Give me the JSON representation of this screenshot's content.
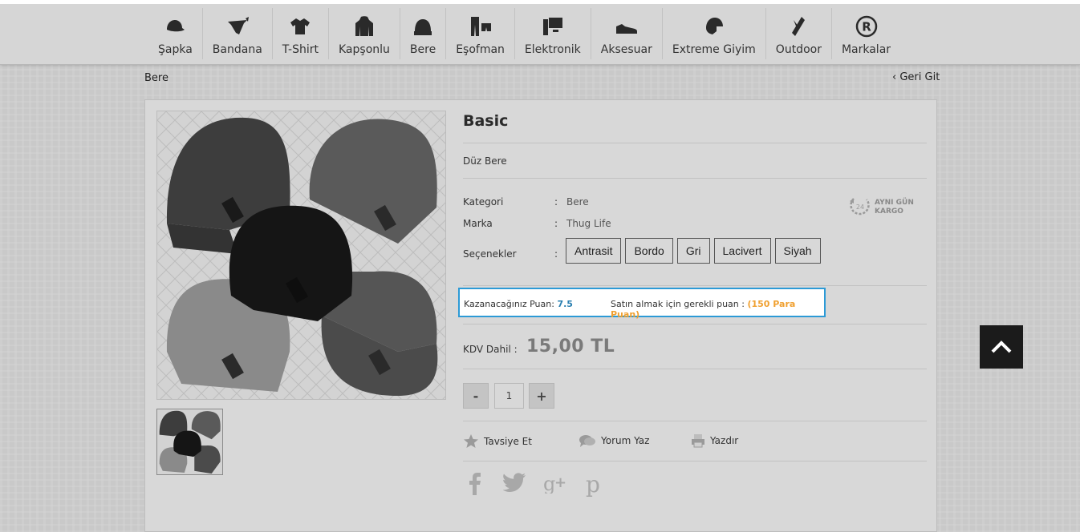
{
  "nav": {
    "items": [
      {
        "label": "Şapka",
        "icon": "cap-icon"
      },
      {
        "label": "Bandana",
        "icon": "bandana-icon"
      },
      {
        "label": "T-Shirt",
        "icon": "tshirt-icon"
      },
      {
        "label": "Kapşonlu",
        "icon": "hoodie-icon"
      },
      {
        "label": "Bere",
        "icon": "beanie-icon"
      },
      {
        "label": "Eşofman",
        "icon": "tracksuit-icon"
      },
      {
        "label": "Elektronik",
        "icon": "computer-icon"
      },
      {
        "label": "Aksesuar",
        "icon": "sneaker-icon"
      },
      {
        "label": "Extreme Giyim",
        "icon": "helmet-icon"
      },
      {
        "label": "Outdoor",
        "icon": "pocket-knife-icon"
      },
      {
        "label": "Markalar",
        "icon": "registered-icon"
      }
    ]
  },
  "breadcrumb": "Bere",
  "back_link": "Geri Git",
  "product": {
    "title": "Basic",
    "description": "Düz Bere",
    "attributes": {
      "category_label": "Kategori",
      "category_value": "Bere",
      "brand_label": "Marka",
      "brand_value": "Thug Life",
      "options_label": "Seçenekler",
      "colon": ":"
    },
    "options": [
      "Antrasit",
      "Bordo",
      "Gri",
      "Lacivert",
      "Siyah"
    ],
    "cargo": {
      "line1": "AYNI GÜN",
      "line2": "KARGO",
      "badge": "24"
    },
    "points": {
      "earn_label": "Kazanacağınız Puan:",
      "earn_value": "7.5",
      "required_label": "Satın almak için gerekli puan :",
      "required_value": "(150 Para Puan)"
    },
    "kdv_label": "KDV Dahil :",
    "price": "15,00 TL",
    "quantity": {
      "minus": "-",
      "value": "1",
      "plus": "+"
    },
    "beanie_label": "THUG LIFE"
  },
  "actions": [
    {
      "label": "Tavsiye Et",
      "icon": "star-icon"
    },
    {
      "label": "Yorum Yaz",
      "icon": "comment-icon"
    },
    {
      "label": "Yazdır",
      "icon": "print-icon"
    }
  ],
  "social": [
    "facebook-icon",
    "twitter-icon",
    "google-plus-icon",
    "pinterest-icon"
  ],
  "colors": {
    "points_border": "#2c9ad6",
    "points_blue": "#2a7fb0",
    "points_orange": "#f0a030",
    "scroll_top_bg": "#1b1b1b"
  }
}
